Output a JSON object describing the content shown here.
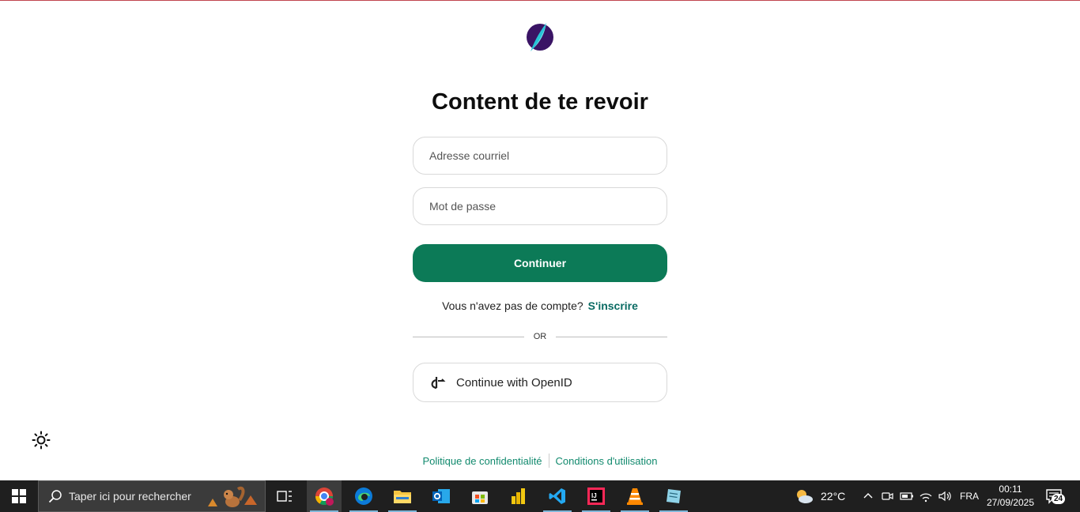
{
  "login": {
    "title": "Content de te revoir",
    "email_placeholder": "Adresse courriel",
    "password_placeholder": "Mot de passe",
    "continue_label": "Continuer",
    "no_account_text": "Vous n'avez pas de compte?",
    "signup_link": "S'inscrire",
    "divider_text": "OR",
    "openid_label": "Continue with OpenID"
  },
  "footer": {
    "privacy_link": "Politique de confidentialité",
    "terms_link": "Conditions d'utilisation"
  },
  "taskbar": {
    "search_placeholder": "Taper ici pour rechercher",
    "weather_temp": "22°C",
    "language": "FRA",
    "time": "00:11",
    "date": "27/09/2025",
    "notification_count": "24"
  },
  "colors": {
    "accent": "#0c7a57",
    "link": "#128a6e",
    "taskbar": "#1f1f1f"
  }
}
